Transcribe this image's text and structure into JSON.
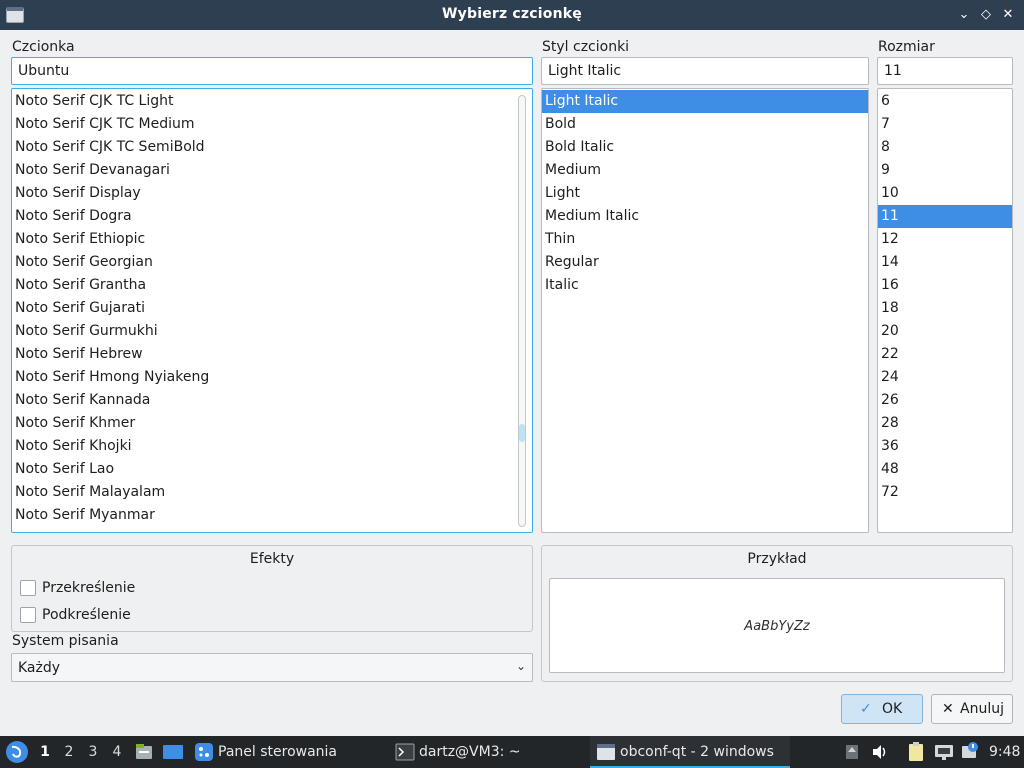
{
  "window": {
    "title": "Wybierz czcionkę"
  },
  "labels": {
    "font": "Czcionka",
    "style": "Styl czcionki",
    "size": "Rozmiar",
    "writing_system": "System pisania"
  },
  "fields": {
    "font_value": "Ubuntu",
    "style_value": "Light Italic",
    "size_value": "11"
  },
  "font_list": [
    "Noto Serif CJK TC Light",
    "Noto Serif CJK TC Medium",
    "Noto Serif CJK TC SemiBold",
    "Noto Serif Devanagari",
    "Noto Serif Display",
    "Noto Serif Dogra",
    "Noto Serif Ethiopic",
    "Noto Serif Georgian",
    "Noto Serif Grantha",
    "Noto Serif Gujarati",
    "Noto Serif Gurmukhi",
    "Noto Serif Hebrew",
    "Noto Serif Hmong Nyiakeng",
    "Noto Serif Kannada",
    "Noto Serif Khmer",
    "Noto Serif Khojki",
    "Noto Serif Lao",
    "Noto Serif Malayalam",
    "Noto Serif Myanmar"
  ],
  "style_list": [
    "Light Italic",
    "Bold",
    "Bold Italic",
    "Medium",
    "Light",
    "Medium Italic",
    "Thin",
    "Regular",
    "Italic"
  ],
  "style_selected_index": 0,
  "size_list": [
    "6",
    "7",
    "8",
    "9",
    "10",
    "11",
    "12",
    "14",
    "16",
    "18",
    "20",
    "22",
    "24",
    "26",
    "28",
    "36",
    "48",
    "72"
  ],
  "size_selected_index": 5,
  "effects": {
    "title": "Efekty",
    "strikeout": "Przekreślenie",
    "underline": "Podkreślenie"
  },
  "preview": {
    "title": "Przykład",
    "sample": "AaBbYyZz"
  },
  "writing_system": {
    "value": "Każdy"
  },
  "buttons": {
    "ok": "OK",
    "cancel": "Anuluj"
  },
  "taskbar": {
    "desktops": [
      "1",
      "2",
      "3",
      "4"
    ],
    "active_desktop": 0,
    "tasks": [
      {
        "label": "Panel sterowania"
      },
      {
        "label": "dartz@VM3: ~"
      },
      {
        "label": "obconf-qt - 2 windows"
      }
    ],
    "clock": "9:48"
  },
  "colors": {
    "accent": "#3d8ee4",
    "titlebar": "#2e3f52",
    "taskbar": "#232629"
  }
}
